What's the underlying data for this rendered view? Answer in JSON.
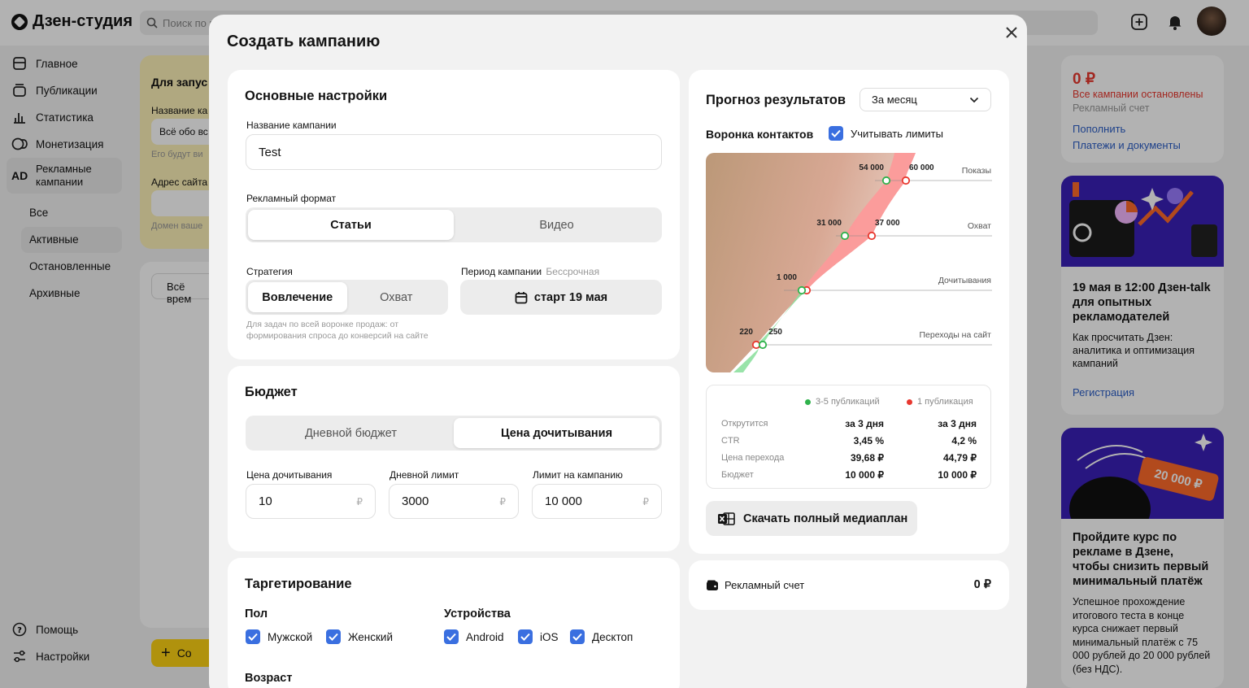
{
  "app": {
    "logo": "Дзен-студия",
    "search_placeholder": "Поиск по п",
    "sidebar": {
      "items": [
        {
          "label": "Главное"
        },
        {
          "label": "Публикации"
        },
        {
          "label": "Статистика"
        },
        {
          "label": "Монетизация"
        }
      ],
      "ad_badge": "AD",
      "ad_label": "Рекламные кампании",
      "sub_items": [
        "Все",
        "Активные",
        "Остановленные",
        "Архивные"
      ],
      "help": "Помощь",
      "settings": "Настройки"
    },
    "bg_card": {
      "title": "Для запус",
      "name_label": "Название ка",
      "name_value": "Всё обо вс",
      "name_hint": "Его будут ви",
      "site_label": "Адрес сайта",
      "site_hint": "Домен ваше",
      "period_button": "Всё врем",
      "create_button": "Со"
    },
    "right_panel": {
      "balance": "0 ₽",
      "status": "Все кампании остановлены",
      "account_label": "Рекламный счет",
      "topup": "Пополнить",
      "payments": "Платежи и документы",
      "promo1": {
        "title": "19 мая в 12:00 Дзен-talk для опытных рекламодателей",
        "text": "Как просчитать Дзен: аналитика и оптимизация кампаний",
        "link": "Регистрация"
      },
      "promo2": {
        "badge": "20 000 ₽",
        "title": "Пройдите курс по рекламе в Дзене, чтобы снизить первый минимальный платёж",
        "text": "Успешное прохождение итогового теста в конце курса снижает первый минимальный платёж с 75 000 рублей до 20 000 рублей (без НДС)."
      }
    }
  },
  "modal": {
    "title": "Создать кампанию",
    "basic": {
      "title": "Основные настройки",
      "name_label": "Название кампании",
      "name_value": "Test",
      "format_label": "Рекламный формат",
      "format_options": [
        "Статьи",
        "Видео"
      ],
      "format_selected": "Статьи",
      "strategy_label": "Стратегия",
      "strategy_options": [
        "Вовлечение",
        "Охват"
      ],
      "strategy_selected": "Вовлечение",
      "strategy_hint": "Для задач по всей воронке продаж: от формирования спроса до конверсий на сайте",
      "period_label": "Период кампании",
      "period_sub": "Бессрочная",
      "period_button": "старт 19 мая"
    },
    "budget": {
      "title": "Бюджет",
      "options": [
        "Дневной бюджет",
        "Цена дочитывания"
      ],
      "selected": "Цена дочитывания",
      "fields": [
        {
          "label": "Цена дочитывания",
          "value": "10",
          "unit": "₽"
        },
        {
          "label": "Дневной лимит",
          "value": "3000",
          "unit": "₽"
        },
        {
          "label": "Лимит на кампанию",
          "value": "10 000",
          "unit": "₽"
        }
      ]
    },
    "targeting": {
      "title": "Таргетирование",
      "gender_label": "Пол",
      "gender": [
        "Мужской",
        "Женский"
      ],
      "devices_label": "Устройства",
      "devices": [
        "Android",
        "iOS",
        "Десктоп"
      ],
      "age_label": "Возраст"
    },
    "forecast": {
      "title": "Прогноз результатов",
      "period": "За месяц",
      "funnel_label": "Воронка контактов",
      "limits_label": "Учитывать лимиты",
      "limits_checked": true,
      "stages": [
        "Показы",
        "Охват",
        "Дочитывания",
        "Переходы на сайт"
      ],
      "legend": [
        "3-5 публикаций",
        "1 публикация"
      ],
      "stats": [
        {
          "label": "Открутится",
          "a": "за 3 дня",
          "b": "за 3 дня"
        },
        {
          "label": "CTR",
          "a": "3,45 %",
          "b": "4,2 %"
        },
        {
          "label": "Цена перехода",
          "a": "39,68 ₽",
          "b": "44,79 ₽"
        },
        {
          "label": "Бюджет",
          "a": "10 000 ₽",
          "b": "10 000 ₽"
        }
      ],
      "download": "Скачать полный медиаплан"
    },
    "account": {
      "label": "Рекламный счет",
      "value": "0 ₽"
    }
  },
  "chart_data": {
    "type": "line",
    "title": "Воронка контактов",
    "categories": [
      "Показы",
      "Охват",
      "Дочитывания",
      "Переходы на сайт"
    ],
    "series": [
      {
        "name": "3-5 публикаций",
        "values": [
          54000,
          31000,
          1000,
          250
        ]
      },
      {
        "name": "1 публикация",
        "values": [
          60000,
          37000,
          1000,
          220
        ]
      }
    ],
    "value_labels": [
      [
        "54 000",
        "60 000"
      ],
      [
        "31 000",
        "37 000"
      ],
      [
        "1 000",
        ""
      ],
      [
        "250",
        "220"
      ]
    ],
    "colors": {
      "green": "#2fb24c",
      "red": "#e8382f"
    }
  }
}
